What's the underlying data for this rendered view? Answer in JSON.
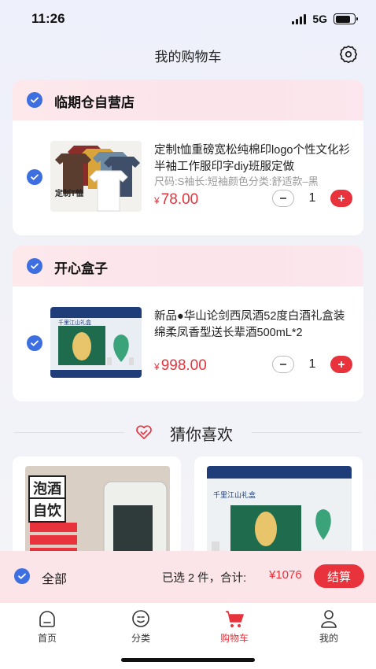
{
  "status_bar": {
    "time": "11:26",
    "network": "5G"
  },
  "header": {
    "title": "我的购物车"
  },
  "shops": [
    {
      "name": "临期仓自营店",
      "item": {
        "title": "定制t恤重磅宽松纯棉印logo个性文化衫半袖工作服印字diy班服定做",
        "spec": "尺码:S袖长:短袖颜色分类:舒适款–黑",
        "price_symbol": "¥",
        "price": "78.00",
        "quantity": "1",
        "thumb_text": "定制T恤"
      }
    },
    {
      "name": "开心盒子",
      "item": {
        "title": "新品●华山论剑西凤酒52度白酒礼盒装绵柔凤香型送长辈酒500mL*2",
        "spec": "",
        "price_symbol": "¥",
        "price": "998.00",
        "quantity": "1",
        "thumb_text": "千里江山礼盒"
      }
    }
  ],
  "recommend": {
    "title": "猜你喜欢",
    "cards": [
      {
        "line1": "泡酒",
        "line2": "自饮"
      },
      {
        "text": "千里江山礼盒"
      }
    ]
  },
  "bottom_bar": {
    "select_all": "全部",
    "summary": "已选 2 件，合计:",
    "total": "¥1076",
    "checkout": "结算"
  },
  "tabs": [
    {
      "label": "首页",
      "icon": "home-icon",
      "active": false
    },
    {
      "label": "分类",
      "icon": "category-icon",
      "active": false
    },
    {
      "label": "购物车",
      "icon": "cart-icon",
      "active": true
    },
    {
      "label": "我的",
      "icon": "profile-icon",
      "active": false
    }
  ],
  "colors": {
    "accent": "#e8333c",
    "check": "#3d6fe0"
  }
}
